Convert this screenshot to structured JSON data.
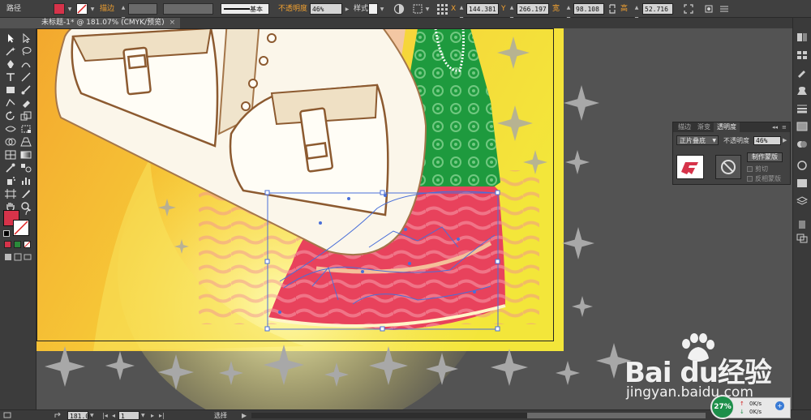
{
  "colors": {
    "fill": "#d6334a",
    "accent_orange": "#f0a030",
    "selection": "#4a6fd8",
    "canvas_bg": "#535353"
  },
  "control_bar": {
    "object_type": "路径",
    "stroke_label": "描边",
    "stroke_profile": "基本",
    "opacity_label": "不透明度",
    "opacity_value": "46%",
    "style_label": "样式",
    "x_label": "X",
    "x_value": "144.381 m",
    "y_label": "Y",
    "y_value": "266.197 m",
    "width_label": "宽",
    "width_value": "98.108 m",
    "height_label": "高",
    "height_value": "52.716 m"
  },
  "document": {
    "tab_title": "未标题-1* @ 181.07% (CMYK/预览)",
    "close_glyph": "×"
  },
  "transparency_panel": {
    "tabs": [
      "描边",
      "渐变",
      "透明度"
    ],
    "active_tab": 2,
    "blend_mode": "正片叠底",
    "opacity_label": "不透明度",
    "opacity_value": "46%",
    "make_mask_label": "制作蒙版",
    "clip_label": "剪切",
    "invert_mask_label": "反相蒙版"
  },
  "status_bar": {
    "zoom_value": "181.07",
    "artboard_value": "1",
    "tool_name": "选择"
  },
  "watermark": {
    "brand": "Bai du经验",
    "url": "jingyan.baidu.com"
  },
  "network_widget": {
    "percent": "27%",
    "up_speed": "0K/s",
    "down_speed": "0K/s"
  }
}
